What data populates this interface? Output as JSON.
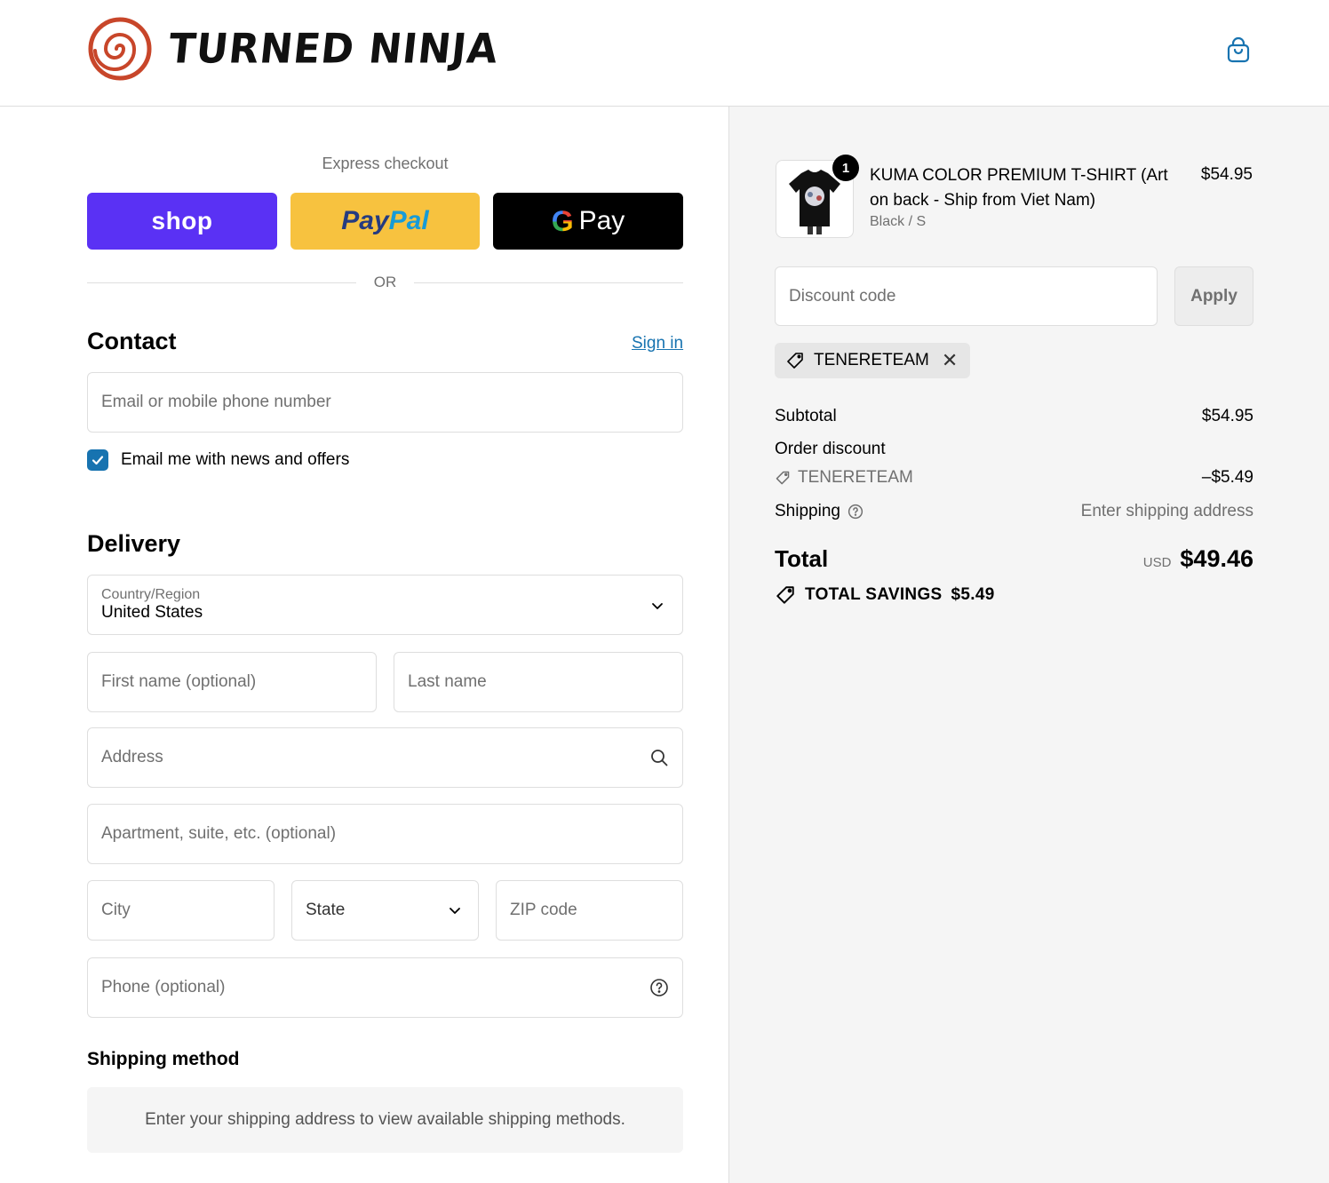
{
  "header": {
    "store_name": "TURNED NINJA",
    "colors": {
      "logo_swirl": "#c8462a",
      "link": "#1773b0"
    }
  },
  "express": {
    "title": "Express checkout",
    "shop_label": "shop",
    "paypal_part1": "Pay",
    "paypal_part2": "Pal",
    "gpay_g": "G",
    "gpay_label": "Pay",
    "or_label": "OR"
  },
  "contact": {
    "heading": "Contact",
    "sign_in": "Sign in",
    "email_placeholder": "Email or mobile phone number",
    "newsletter_label": "Email me with news and offers",
    "newsletter_checked": true
  },
  "delivery": {
    "heading": "Delivery",
    "country_label": "Country/Region",
    "country_value": "United States",
    "first_name_placeholder": "First name (optional)",
    "last_name_placeholder": "Last name",
    "address_placeholder": "Address",
    "apartment_placeholder": "Apartment, suite, etc. (optional)",
    "city_placeholder": "City",
    "state_placeholder": "State",
    "zip_placeholder": "ZIP code",
    "phone_placeholder": "Phone (optional)"
  },
  "shipping_method": {
    "heading": "Shipping method",
    "message": "Enter your shipping address to view available shipping methods."
  },
  "summary": {
    "product": {
      "quantity": "1",
      "title": "KUMA COLOR PREMIUM T-SHIRT (Art on back - Ship from Viet Nam)",
      "variant": "Black / S",
      "price": "$54.95"
    },
    "discount_placeholder": "Discount code",
    "apply_label": "Apply",
    "applied_code": "TENERETEAM",
    "subtotal_label": "Subtotal",
    "subtotal_value": "$54.95",
    "order_discount_label": "Order discount",
    "order_discount_code": "TENERETEAM",
    "order_discount_value": "–$5.49",
    "shipping_label": "Shipping",
    "shipping_value": "Enter shipping address",
    "total_label": "Total",
    "currency": "USD",
    "total_value": "$49.46",
    "savings_label": "TOTAL SAVINGS",
    "savings_value": "$5.49"
  }
}
